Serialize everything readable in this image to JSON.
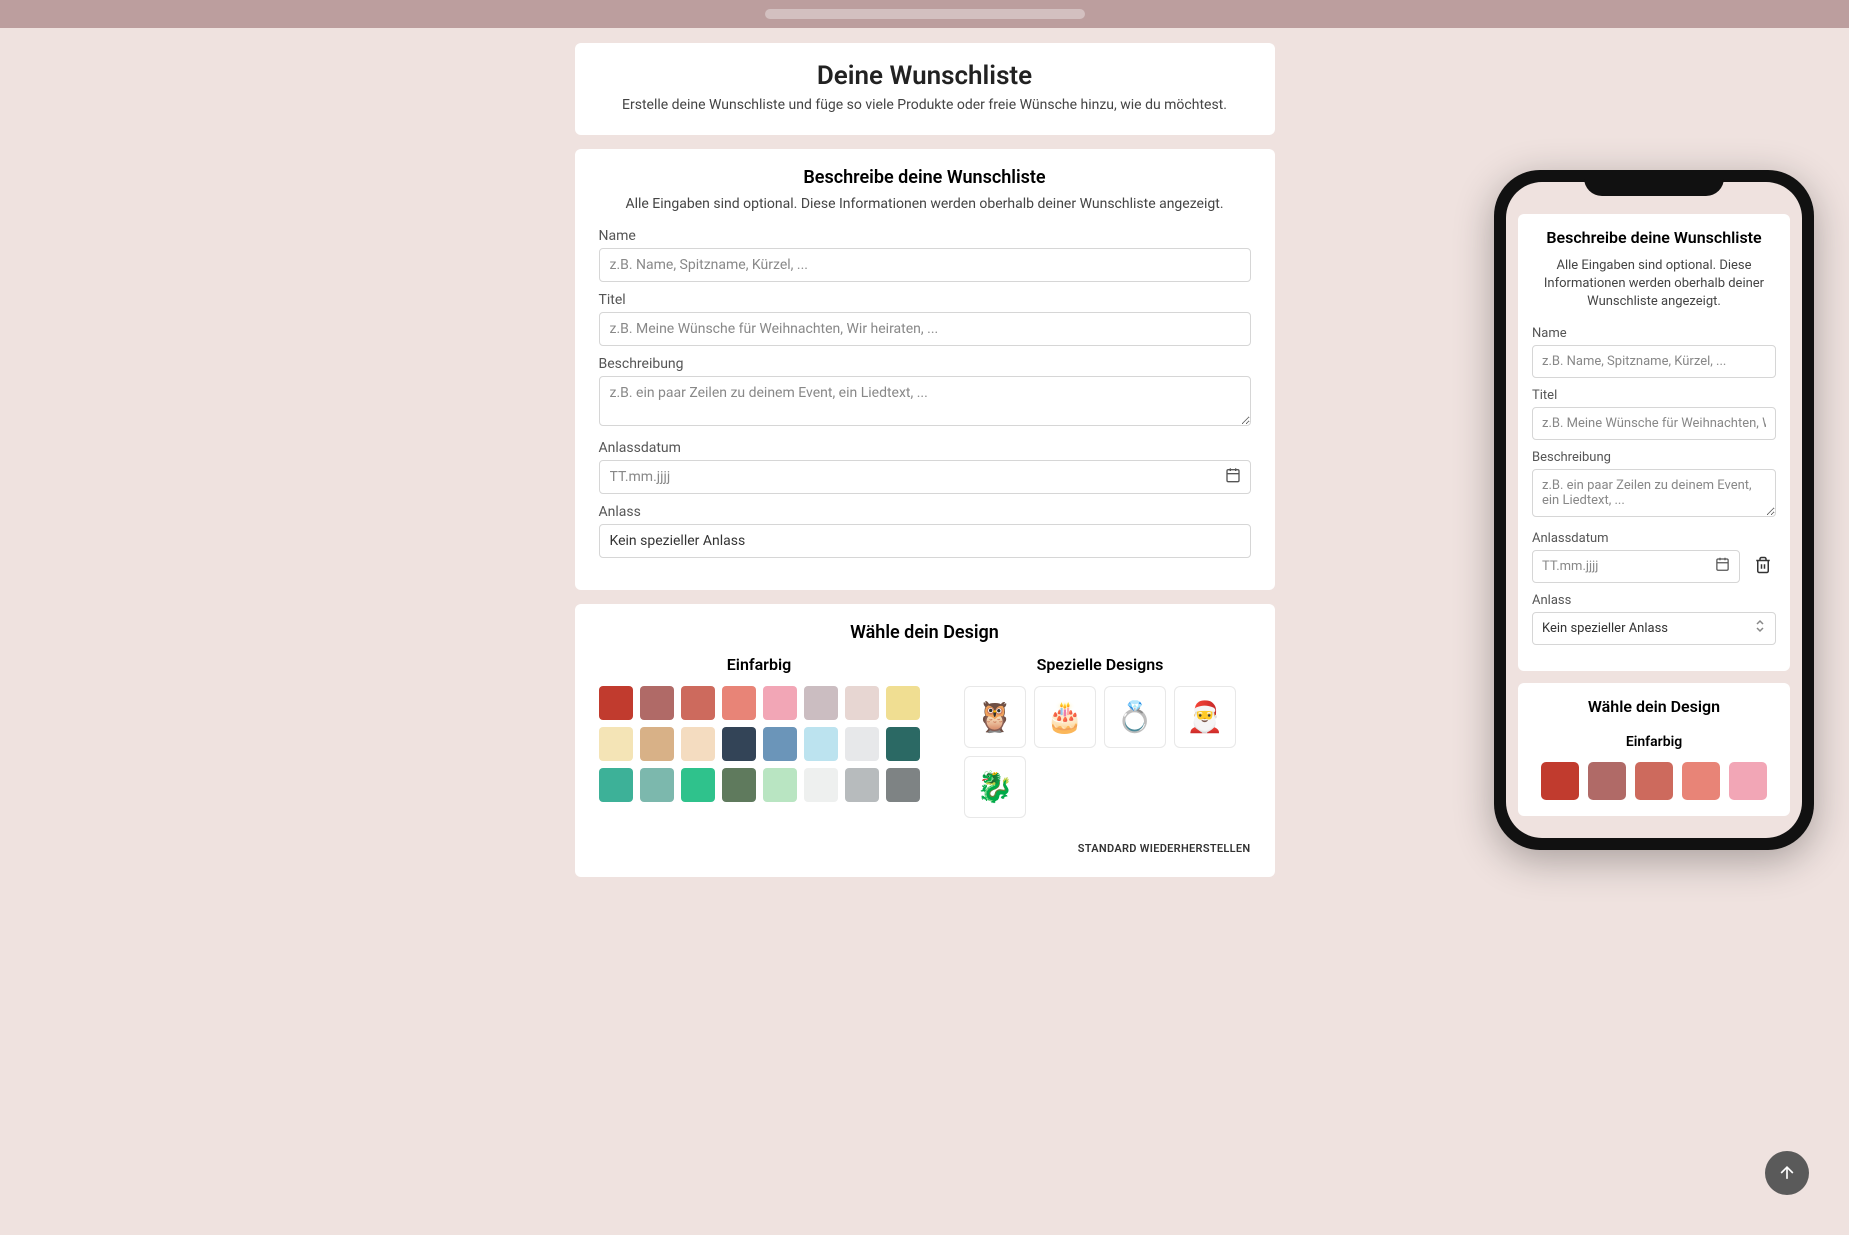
{
  "header": {
    "title": "Deine Wunschliste",
    "subtitle": "Erstelle deine Wunschliste und füge so viele Produkte oder freie Wünsche hinzu, wie du möchtest."
  },
  "describe": {
    "title": "Beschreibe deine Wunschliste",
    "desc": "Alle Eingaben sind optional. Diese Informationen werden oberhalb deiner Wunschliste angezeigt.",
    "name_label": "Name",
    "name_placeholder": "z.B. Name, Spitzname, Kürzel, ...",
    "title_label": "Titel",
    "title_placeholder": "z.B. Meine Wünsche für Weihnachten, Wir heiraten, ...",
    "desc_label": "Beschreibung",
    "desc_placeholder": "z.B. ein paar Zeilen zu deinem Event, ein Liedtext, ...",
    "date_label": "Anlassdatum",
    "date_placeholder": "TT.mm.jjjj",
    "occasion_label": "Anlass",
    "occasion_value": "Kein spezieller Anlass"
  },
  "design": {
    "title": "Wähle dein Design",
    "solid_title": "Einfarbig",
    "special_title": "Spezielle Designs",
    "restore": "STANDARD WIEDERHERSTELLEN",
    "colors": [
      "#c13b2e",
      "#b06a67",
      "#cd6a5d",
      "#e88477",
      "#f2a6b6",
      "#cbbdc1",
      "#e7d6d2",
      "#f0de92",
      "#f4e4b6",
      "#d8b187",
      "#f4dcc0",
      "#334457",
      "#6b95b9",
      "#bce3ef",
      "#e7e8ea",
      "#2b6964",
      "#3db198",
      "#7cb8ad",
      "#2fc28c",
      "#5f7a5d",
      "#b9e5c2",
      "#eef0ef",
      "#b7bbbd",
      "#7e8384"
    ],
    "special_icons": [
      "owl-party",
      "birthday-cake",
      "wedding-rings",
      "santa",
      "dragon"
    ]
  },
  "phone": {
    "describe": {
      "title": "Beschreibe deine Wunschliste",
      "desc": "Alle Eingaben sind optional. Diese Informationen werden oberhalb deiner Wunschliste angezeigt.",
      "name_label": "Name",
      "name_placeholder": "z.B. Name, Spitzname, Kürzel, ...",
      "title_label": "Titel",
      "title_placeholder": "z.B. Meine Wünsche für Weihnachten, Wir he",
      "desc_label": "Beschreibung",
      "desc_placeholder": "z.B. ein paar Zeilen zu deinem Event, ein Liedtext, ...",
      "date_label": "Anlassdatum",
      "date_placeholder": "TT.mm.jjjj",
      "occasion_label": "Anlass",
      "occasion_value": "Kein spezieller Anlass"
    },
    "design": {
      "title": "Wähle dein Design",
      "solid_title": "Einfarbig",
      "colors": [
        "#c13b2e",
        "#b06a67",
        "#cd6a5d",
        "#e88477",
        "#f2a6b6"
      ]
    }
  }
}
